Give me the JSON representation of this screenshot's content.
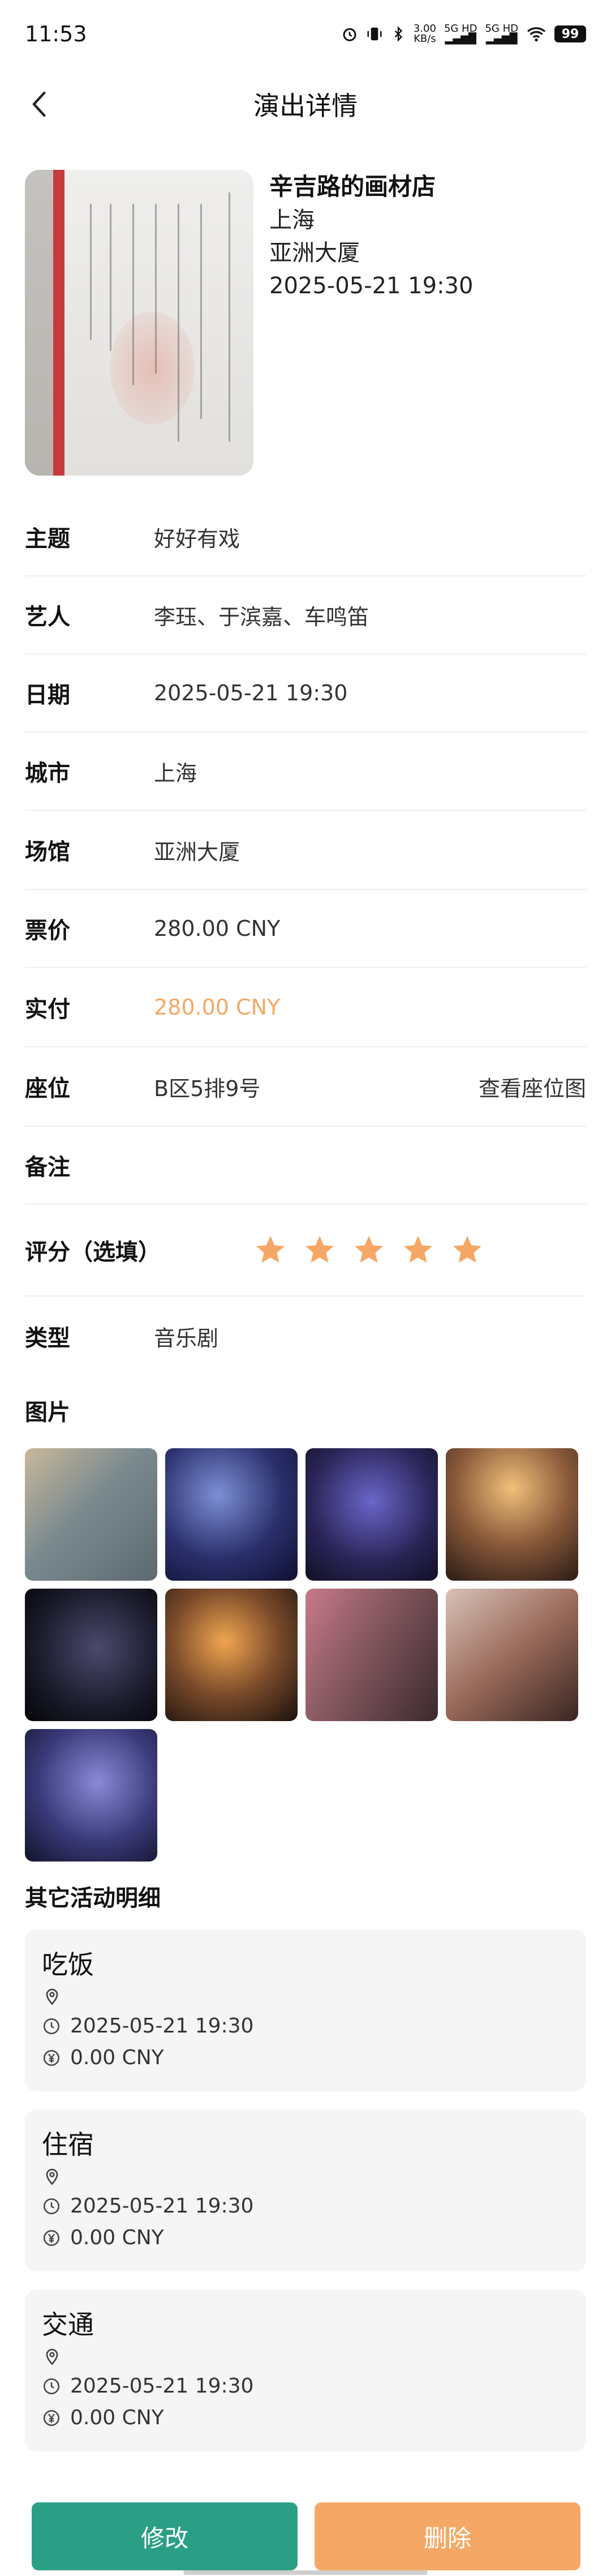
{
  "status_bar": {
    "time": "11:53",
    "net_speed": "3.00",
    "net_unit": "KB/s",
    "signal1": "5G HD",
    "signal2": "5G HD",
    "battery": "99"
  },
  "header": {
    "title": "演出详情"
  },
  "hero": {
    "title": "辛吉路的画材店",
    "city": "上海",
    "venue": "亚洲大厦",
    "datetime": "2025-05-21 19:30"
  },
  "rows": {
    "theme": {
      "label": "主题",
      "value": "好好有戏"
    },
    "artists": {
      "label": "艺人",
      "value": "李珏、于滨嘉、车鸣笛"
    },
    "date": {
      "label": "日期",
      "value": "2025-05-21 19:30"
    },
    "city": {
      "label": "城市",
      "value": "上海"
    },
    "venue": {
      "label": "场馆",
      "value": "亚洲大厦"
    },
    "price": {
      "label": "票价",
      "value": "280.00 CNY"
    },
    "paid": {
      "label": "实付",
      "value": "280.00 CNY"
    },
    "seat": {
      "label": "座位",
      "value": "B区5排9号",
      "link": "查看座位图"
    },
    "note": {
      "label": "备注",
      "value": ""
    },
    "rating": {
      "label": "评分（选填）",
      "stars": 5,
      "star_color": "#f5a865"
    },
    "type": {
      "label": "类型",
      "value": "音乐剧"
    }
  },
  "gallery": {
    "label": "图片",
    "count": 9
  },
  "activities": {
    "label": "其它活动明细",
    "items": [
      {
        "title": "吃饭",
        "location": "",
        "time": "2025-05-21 19:30",
        "cost": "0.00 CNY"
      },
      {
        "title": "住宿",
        "location": "",
        "time": "2025-05-21 19:30",
        "cost": "0.00 CNY"
      },
      {
        "title": "交通",
        "location": "",
        "time": "2025-05-21 19:30",
        "cost": "0.00 CNY"
      }
    ]
  },
  "actions": {
    "edit": "修改",
    "delete": "删除",
    "edit_color": "#2a9f86",
    "delete_color": "#f5a865"
  }
}
